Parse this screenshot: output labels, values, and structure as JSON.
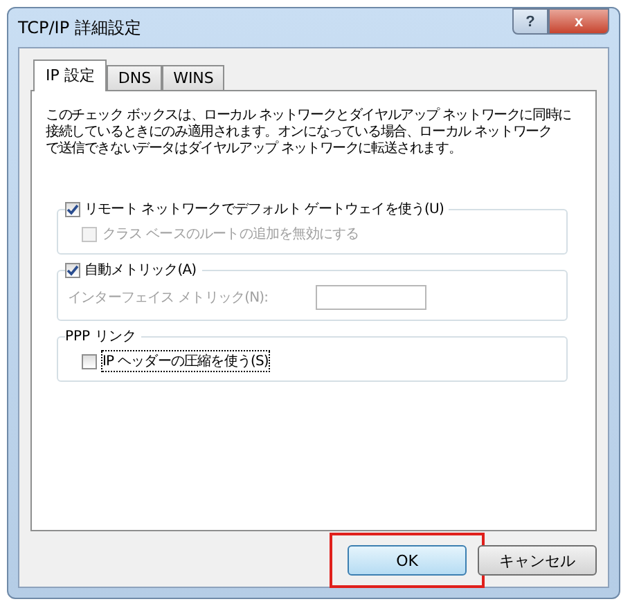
{
  "window": {
    "title": "TCP/IP 詳細設定",
    "help": "?",
    "close": "x"
  },
  "tabs": [
    {
      "label": "IP 設定",
      "selected": true
    },
    {
      "label": "DNS",
      "selected": false
    },
    {
      "label": "WINS",
      "selected": false
    }
  ],
  "description": [
    "このチェック ボックスは、ローカル ネットワークとダイヤルアップ ネットワークに同時に",
    "接続しているときにのみ適用されます。オンになっている場合、ローカル ネットワーク",
    "で送信できないデータはダイヤルアップ ネットワークに転送されます。"
  ],
  "groups": [
    {
      "header": {
        "kind": "checkbox",
        "label": "リモート ネットワークでデフォルト ゲートウェイを使う(U)",
        "checked": true
      },
      "items": [
        {
          "kind": "checkbox",
          "label": "クラス ベースのルートの追加を無効にする",
          "checked": false,
          "disabled": true,
          "focused": false
        }
      ]
    },
    {
      "header": {
        "kind": "checkbox",
        "label": "自動メトリック(A)",
        "checked": true
      },
      "items": [
        {
          "kind": "field",
          "label": "インターフェイス メトリック(N):",
          "value": "",
          "disabled": true
        }
      ]
    },
    {
      "header": {
        "kind": "text",
        "label": "PPP リンク"
      },
      "items": [
        {
          "kind": "checkbox",
          "label": "IP ヘッダーの圧縮を使う(S)",
          "checked": false,
          "disabled": false,
          "focused": true
        }
      ]
    }
  ],
  "buttons": [
    {
      "label": "OK",
      "default": true,
      "highlighted": true
    },
    {
      "label": "キャンセル",
      "default": false,
      "highlighted": false
    }
  ]
}
